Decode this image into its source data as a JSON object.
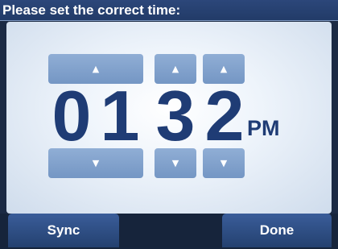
{
  "title": "Please set the correct time:",
  "time": {
    "hour_tens": "0",
    "hour_ones": "1",
    "minute_tens": "3",
    "minute_ones": "2",
    "meridiem": "PM"
  },
  "icons": {
    "up": "▲",
    "down": "▼"
  },
  "buttons": {
    "sync_label": "Sync",
    "done_label": "Done"
  },
  "colors": {
    "digit": "#1f3c75",
    "arrow_button": "#7f9fcc",
    "title_bar": "#2a4574"
  }
}
